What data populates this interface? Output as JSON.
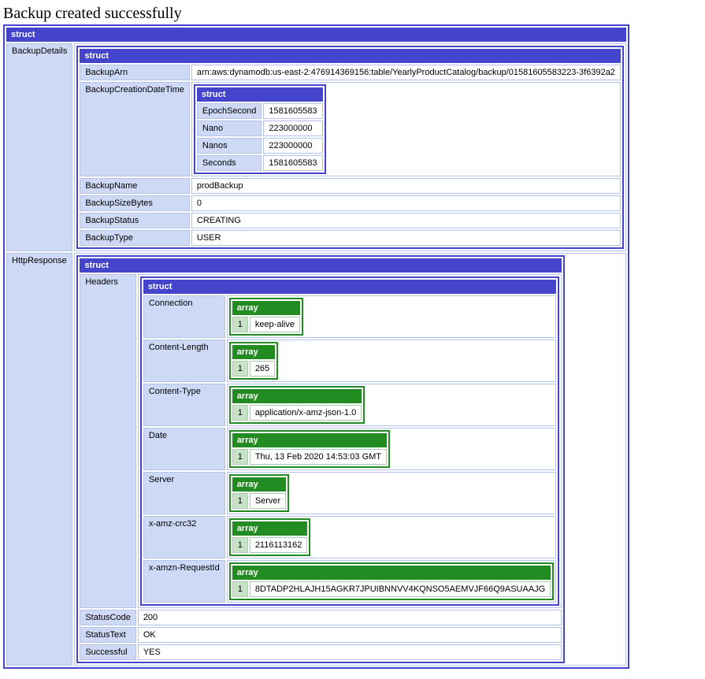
{
  "title": "Backup created successfully",
  "struct_label": "struct",
  "array_label": "array",
  "root": {
    "BackupDetails": {
      "label": "BackupDetails",
      "BackupArn": {
        "label": "BackupArn",
        "value": "arn:aws:dynamodb:us-east-2:476914369156:table/YearlyProductCatalog/backup/01581605583223-3f6392a2"
      },
      "BackupCreationDateTime": {
        "label": "BackupCreationDateTime",
        "EpochSecond": {
          "label": "EpochSecond",
          "value": "1581605583"
        },
        "Nano": {
          "label": "Nano",
          "value": "223000000"
        },
        "Nanos": {
          "label": "Nanos",
          "value": "223000000"
        },
        "Seconds": {
          "label": "Seconds",
          "value": "1581605583"
        }
      },
      "BackupName": {
        "label": "BackupName",
        "value": "prodBackup"
      },
      "BackupSizeBytes": {
        "label": "BackupSizeBytes",
        "value": "0"
      },
      "BackupStatus": {
        "label": "BackupStatus",
        "value": "CREATING"
      },
      "BackupType": {
        "label": "BackupType",
        "value": "USER"
      }
    },
    "HttpResponse": {
      "label": "HttpResponse",
      "Headers": {
        "label": "Headers",
        "Connection": {
          "label": "Connection",
          "index": "1",
          "value": "keep-alive"
        },
        "ContentLength": {
          "label": "Content-Length",
          "index": "1",
          "value": "265"
        },
        "ContentType": {
          "label": "Content-Type",
          "index": "1",
          "value": "application/x-amz-json-1.0"
        },
        "Date": {
          "label": "Date",
          "index": "1",
          "value": "Thu, 13 Feb 2020 14:53:03 GMT"
        },
        "Server": {
          "label": "Server",
          "index": "1",
          "value": "Server"
        },
        "XAmzCrc32": {
          "label": "x-amz-crc32",
          "index": "1",
          "value": "2116113162"
        },
        "XAmznRequestId": {
          "label": "x-amzn-RequestId",
          "index": "1",
          "value": "8DTADP2HLAJH15AGKR7JPUIBNNVV4KQNSO5AEMVJF66Q9ASUAAJG"
        }
      },
      "StatusCode": {
        "label": "StatusCode",
        "value": "200"
      },
      "StatusText": {
        "label": "StatusText",
        "value": "OK"
      },
      "Successful": {
        "label": "Successful",
        "value": "YES"
      }
    }
  }
}
